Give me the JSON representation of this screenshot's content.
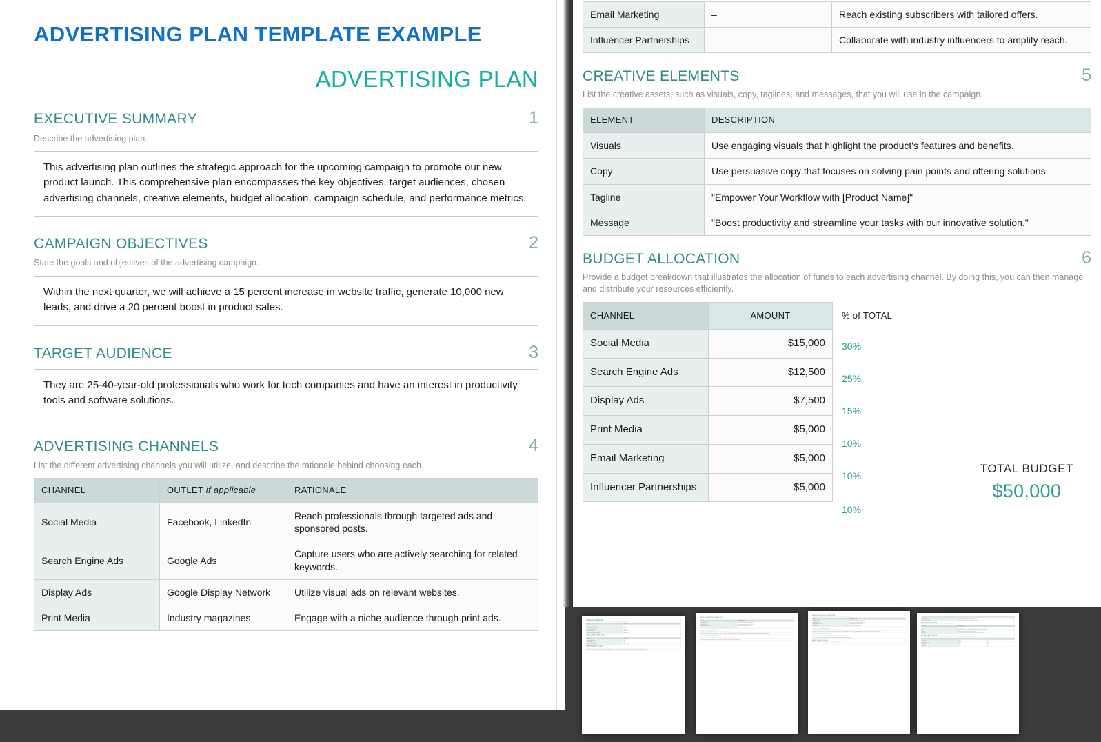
{
  "left_page": {
    "doc_title": "ADVERTISING PLAN TEMPLATE EXAMPLE",
    "doc_subtitle": "ADVERTISING PLAN",
    "sections": [
      {
        "number": "1",
        "title": "EXECUTIVE SUMMARY",
        "description": "Describe the advertising plan.",
        "body": "This advertising plan outlines the strategic approach for the upcoming campaign to promote our new product launch. This comprehensive plan encompasses the key objectives, target audiences, chosen advertising channels, creative elements, budget allocation, campaign schedule, and performance metrics."
      },
      {
        "number": "2",
        "title": "CAMPAIGN OBJECTIVES",
        "description": "State the goals and objectives of the advertising campaign.",
        "body": "Within the next quarter, we will achieve a 15 percent increase in website traffic, generate 10,000 new leads, and drive a 20 percent boost in product sales."
      },
      {
        "number": "3",
        "title": "TARGET AUDIENCE",
        "description": "",
        "body": "They are 25-40-year-old professionals who work for tech companies and have an interest in productivity tools and software solutions."
      },
      {
        "number": "4",
        "title": "ADVERTISING CHANNELS",
        "description": "List the different advertising channels you will utilize, and describe the rationale behind choosing each.",
        "body": ""
      }
    ],
    "channels_table": {
      "headers": [
        "CHANNEL",
        "OUTLET",
        "RATIONALE"
      ],
      "outlet_italic_suffix": "if applicable",
      "rows": [
        [
          "Social Media",
          "Facebook, LinkedIn",
          "Reach professionals through targeted ads and sponsored posts."
        ],
        [
          "Search Engine Ads",
          "Google Ads",
          "Capture users who are actively searching for related keywords."
        ],
        [
          "Display Ads",
          "Google Display Network",
          "Utilize visual ads on relevant websites."
        ],
        [
          "Print Media",
          "Industry magazines",
          "Engage with a niche audience through print ads."
        ]
      ]
    }
  },
  "right_page": {
    "channels_continued": {
      "rows": [
        [
          "Email Marketing",
          "–",
          "Reach existing subscribers with tailored offers."
        ],
        [
          "Influencer Partnerships",
          "–",
          "Collaborate with industry influencers to amplify reach."
        ]
      ]
    },
    "creative": {
      "number": "5",
      "title": "CREATIVE ELEMENTS",
      "description": "List the creative assets, such as visuals, copy, taglines, and messages, that you will use in the campaign.",
      "headers": [
        "ELEMENT",
        "DESCRIPTION"
      ],
      "rows": [
        [
          "Visuals",
          "Use engaging visuals that highlight the product's features and benefits."
        ],
        [
          "Copy",
          "Use persuasive copy that focuses on solving pain points and offering solutions."
        ],
        [
          "Tagline",
          "\"Empower Your Workflow with [Product Name]\""
        ],
        [
          "Message",
          "\"Boost productivity and streamline your tasks with our innovative solution.\""
        ]
      ]
    },
    "budget": {
      "number": "6",
      "title": "BUDGET ALLOCATION",
      "description": "Provide a budget breakdown that illustrates the allocation of funds to each advertising channel. By doing this, you can then manage and distribute your resources efficiently.",
      "headers": [
        "CHANNEL",
        "AMOUNT",
        "% of TOTAL"
      ],
      "rows": [
        [
          "Social Media",
          "$15,000",
          "30%"
        ],
        [
          "Search Engine Ads",
          "$12,500",
          "25%"
        ],
        [
          "Display Ads",
          "$7,500",
          "15%"
        ],
        [
          "Print Media",
          "$5,000",
          "10%"
        ],
        [
          "Email Marketing",
          "$5,000",
          "10%"
        ],
        [
          "Influencer Partnerships",
          "$5,000",
          "10%"
        ]
      ],
      "total_label": "TOTAL BUDGET",
      "total_value": "$50,000"
    }
  },
  "thumbnails": [
    {
      "sections": [
        {
          "number": "7",
          "title": "CAMPAIGN SCHEDULE",
          "desc": "Create a timeline that indicates when you will execute each phase of the campaign, thus allowing for a timely and effective execution.",
          "headers": [
            "PHASE",
            "TIMELINE"
          ],
          "rows": [
            [
              "Planning and Creative Development",
              "Weeks 1 – 2"
            ],
            [
              "Content Creation and Approval",
              "Weeks 3 – 4"
            ],
            [
              "Final Launch Preparation",
              "Weeks 5 – 6"
            ],
            [
              "Campaign Launch",
              "Week 7"
            ],
            [
              "Ongoing Monitoring and Optimization",
              "Weeks 8 – 12"
            ]
          ]
        },
        {
          "number": "8",
          "title": "PERFORMANCE METRICS",
          "desc": "Outline the key performance indicators (KPIs) that you will use to measure the campaign's success, such as website visits, click-through rates, conversion rates, and more.",
          "headers": [
            "METRIC",
            "TARGET"
          ],
          "rows": [
            [
              "Click-through Rate (CTR)",
              "5%"
            ],
            [
              "Conversion Rate",
              "15%"
            ],
            [
              "Return on Investment (ROI)",
              "Target 4x ROI"
            ]
          ]
        },
        {
          "number": "9",
          "title": "CONTINGENCY PLANS",
          "desc": "Identify potential challenges or issues that might arise during the campaign, then outline contingency measures.",
          "body": "In case of any unforeseen challenges, we will adjust the campaign strategy, reallocate budget, and explore alternative channels to maintain campaign effectiveness."
        }
      ]
    },
    {
      "sections": [
        {
          "number": "10",
          "title": "ROLES AND RESPONSIBILITIES",
          "desc": "Specify who is responsible for each of the key tasks and activities that are essential to the campaign's planning and execution.",
          "headers": [
            "ROLE",
            "RESPONSIBILITIES"
          ],
          "rows": [
            [
              "Marketing Manager",
              "Overall campaign strategy and coordination."
            ],
            [
              "Creative Team",
              "Development of visuals, copy, and taglines."
            ],
            [
              "Digital Marketing Specialist",
              "Execution of digital advertising efforts."
            ],
            [
              "Sales Team",
              "Lead management and follow-up."
            ]
          ]
        },
        {
          "number": "11",
          "title": "COMPETITOR ANALYSIS",
          "desc": "Analyze your competitors' strategies and advertising activities, then compare them to your own.",
          "body": "Competitor X focuses on price, while Competitor Y emphasizes features. Our campaign positions our product as the solution that delivers a balance of features and advanced functionality."
        },
        {
          "number": "12",
          "title": "LEGAL AND COMPLIANCE",
          "desc": "Detail specific legal and compliance requirements, including any internal and external policies and restrictions.",
          "body": "Ensure that all advertising materials comply with industry regulations and our company's ethical standards."
        }
      ]
    },
    {
      "sections": [
        {
          "number": "10",
          "title": "ROLES AND RESPONSIBILITIES",
          "desc": "Specify who is responsible for each of the key tasks and activities that are essential to the campaign's planning and execution.",
          "headers": [
            "ROLE",
            "RESPONSIBILITIES"
          ],
          "rows": [
            [
              "Marketing Manager",
              "Overall campaign strategy and coordination."
            ],
            [
              "Creative Team",
              "Development of visuals, copy, and taglines."
            ],
            [
              "Digital Marketing Specialist",
              "Execution of digital advertising efforts."
            ],
            [
              "Sales Team",
              "Lead management and follow-up."
            ]
          ]
        },
        {
          "number": "11",
          "title": "COMPETITOR ANALYSIS",
          "desc": "Analyze your competitors' strategies and advertising activities, then compare them to your own.",
          "body": "Competitor X focuses on price, while Competitor Y emphasizes features. Our campaign positions our product as the solution that delivers a balance of features and advanced functionality."
        },
        {
          "number": "12",
          "title": "LEGAL AND COMPLIANCE",
          "desc": "Detail specific legal and compliance requirements, including any internal and external policies and restrictions.",
          "body": "Ensure that all advertising materials comply with industry regulations and our company's ethical standards."
        },
        {
          "number": "13",
          "title": "APPROVAL PROCESS",
          "desc": "Describe the approval process for the campaign, and who has the ultimate sign-off authority.",
          "body": "The Marketing Manager, Creative Lead, and Legal Department will review and give approval for the campaign elements."
        }
      ]
    },
    {
      "sections": [
        {
          "number": "",
          "title": "",
          "desc": "",
          "headers": [
            "",
            ""
          ],
          "rows": [
            [
              "Email Marketing",
              "Reach existing subscribers with tailored offers."
            ],
            [
              "Influencer Partnerships",
              "Collaborate with industry influencers to amplify reach."
            ]
          ]
        },
        {
          "number": "5",
          "title": "CREATIVE ELEMENTS",
          "desc": "List the creative assets, such as visuals, copy, taglines, and messages, that you will use in the campaign.",
          "headers": [
            "ELEMENT",
            "DESCRIPTION"
          ],
          "rows": [
            [
              "Visuals",
              "Use engaging visuals that highlight the product's features and benefits."
            ],
            [
              "Copy",
              "Use persuasive copy that focuses on solving pain points and offering solutions."
            ],
            [
              "Tagline",
              "\"Empower Your Workflow with [Product Name]\""
            ],
            [
              "Message",
              "\"Boost productivity and streamline your tasks with our innovative solution.\""
            ]
          ]
        },
        {
          "number": "6",
          "title": "BUDGET ALLOCATION",
          "desc": "Provide a budget breakdown that illustrates the allocation of funds to each advertising channel. By doing this, you can then manage and distribute your resources efficiently.",
          "headers": [
            "CHANNEL",
            "AMOUNT",
            "% of TOTAL"
          ],
          "rows": [
            [
              "Social Media",
              "$15,000",
              "30%"
            ],
            [
              "Search Engine Ads",
              "$12,500",
              "25%"
            ],
            [
              "Display Ads",
              "$7,500",
              "15%"
            ],
            [
              "Print Media",
              "$5,000",
              "10%"
            ]
          ]
        }
      ]
    }
  ],
  "colors": {
    "title_blue": "#1271c6",
    "bright_teal": "#15ada0",
    "heading_teal": "#2f8c86",
    "number_sage": "#7fa9a4",
    "table_header": "#cbdad8",
    "table_header_light": "#d9e8e6",
    "table_col1": "#e7f0ef",
    "dark_strip": "#3c3c3c"
  }
}
